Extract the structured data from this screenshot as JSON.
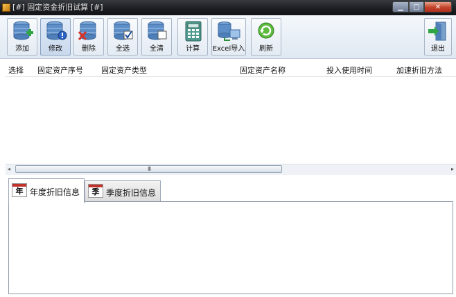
{
  "window": {
    "title": "[#] 固定资金折旧试算 [#]",
    "minimize_glyph": "▁",
    "maximize_glyph": "□",
    "close_glyph": "✕"
  },
  "toolbar": {
    "buttons": [
      {
        "label": "添加",
        "icon": "database-add-icon"
      },
      {
        "label": "修改",
        "icon": "database-edit-icon"
      },
      {
        "label": "删除",
        "icon": "database-delete-icon"
      },
      {
        "label": "全选",
        "icon": "database-check-icon"
      },
      {
        "label": "全清",
        "icon": "database-clear-icon"
      },
      {
        "label": "计算",
        "icon": "calculator-icon"
      },
      {
        "label": "Excel导入",
        "icon": "excel-import-icon"
      },
      {
        "label": "刷新",
        "icon": "refresh-icon"
      },
      {
        "label": "退出",
        "icon": "exit-door-icon"
      }
    ]
  },
  "table": {
    "columns": [
      "选择",
      "固定资产序号",
      "固定资产类型",
      "固定资产名称",
      "投入使用时间",
      "加速折旧方法"
    ],
    "rows": []
  },
  "scrollbar": {
    "left_arrow": "◂",
    "right_arrow": "▸",
    "grip": "III"
  },
  "tabs": [
    {
      "label": "年度折旧信息",
      "icon_char": "年",
      "active": true
    },
    {
      "label": "季度折旧信息",
      "icon_char": "季",
      "active": false
    }
  ]
}
